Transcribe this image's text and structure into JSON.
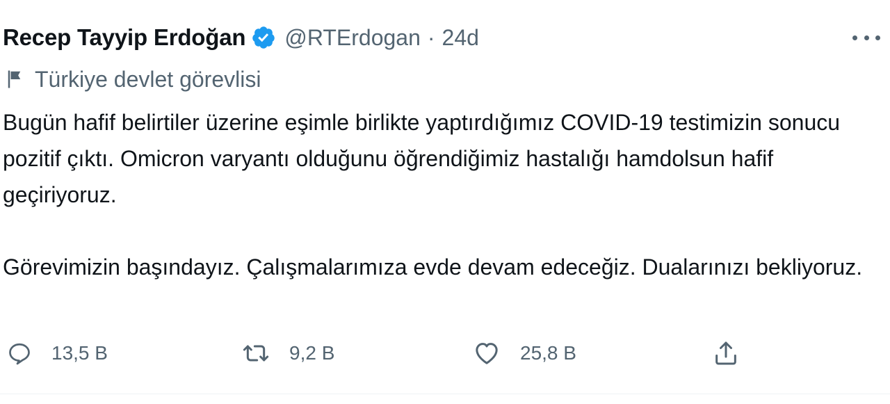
{
  "author": {
    "name": "Recep Tayyip Erdoğan",
    "handle": "@RTErdogan",
    "separator": "·",
    "time": "24d",
    "verified_icon": "verified-badge-icon"
  },
  "account_label": {
    "icon": "flag-icon",
    "text": "Türkiye devlet görevlisi"
  },
  "tweet": {
    "paragraph_1": "Bugün hafif belirtiler üzerine eşimle birlikte yaptırdığımız COVID-19 testimizin sonucu pozitif çıktı. Omicron varyantı olduğunu öğrendiğimiz hastalığı hamdolsun hafif geçiriyoruz.",
    "paragraph_2": "Görevimizin başındayız. Çalışmalarımıza evde devam edeceğiz. Dualarınızı bekliyoruz."
  },
  "actions": {
    "reply": {
      "icon": "reply-icon",
      "count": "13,5 B"
    },
    "retweet": {
      "icon": "retweet-icon",
      "count": "9,2 B"
    },
    "like": {
      "icon": "heart-icon",
      "count": "25,8 B"
    },
    "share": {
      "icon": "share-icon"
    }
  },
  "colors": {
    "text": "#0f1419",
    "secondary": "#536471",
    "verified": "#1d9bf0"
  }
}
